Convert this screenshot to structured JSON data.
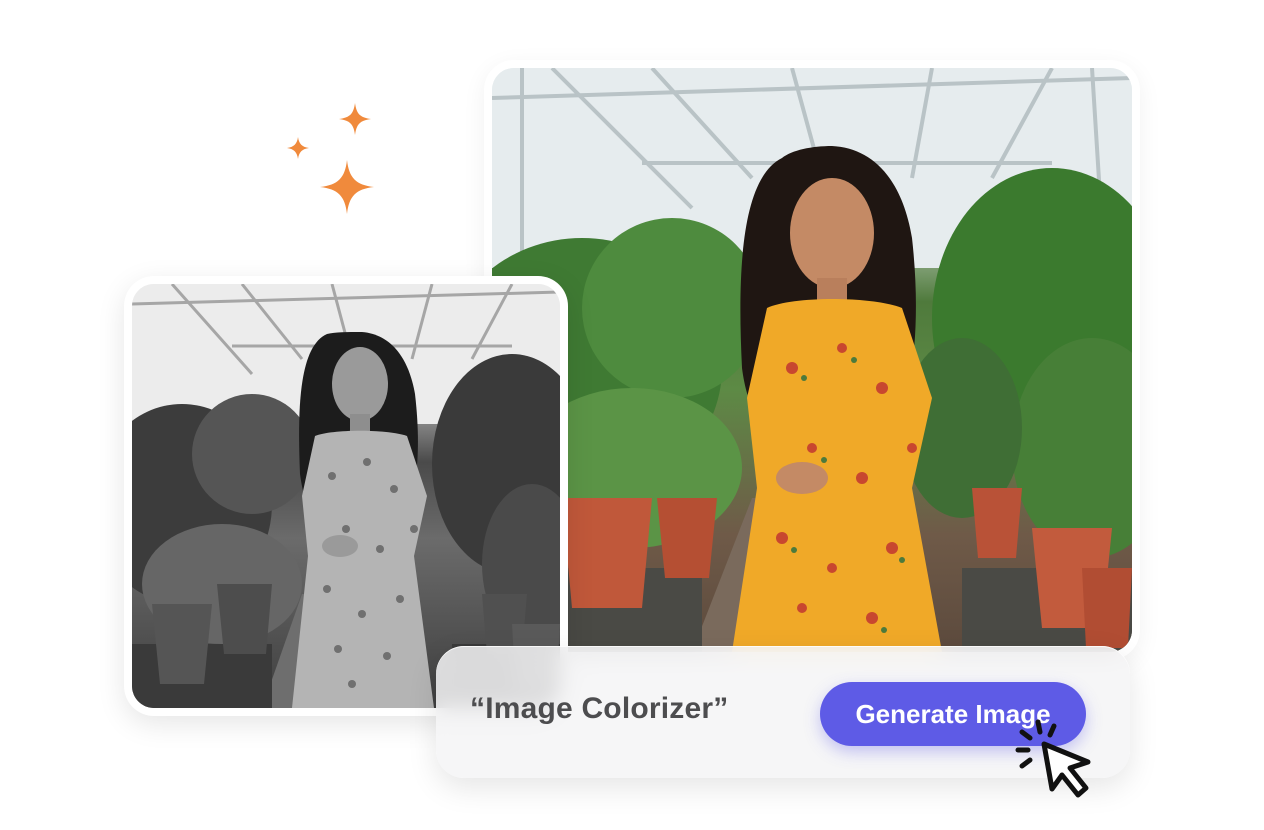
{
  "prompt": {
    "text": "“Image Colorizer”",
    "button_label": "Generate Image"
  },
  "images": {
    "original": {
      "description_icon": "grayscale-photo",
      "style": "black-and-white"
    },
    "result": {
      "description_icon": "colorized-photo",
      "style": "color"
    }
  },
  "colors": {
    "accent": "#5e5be6",
    "sparkle": "#f08a3c",
    "prompt_text": "#4d4d4f",
    "dress": "#f0a928"
  },
  "icons": [
    "sparkle-icon",
    "cursor-click-icon"
  ]
}
